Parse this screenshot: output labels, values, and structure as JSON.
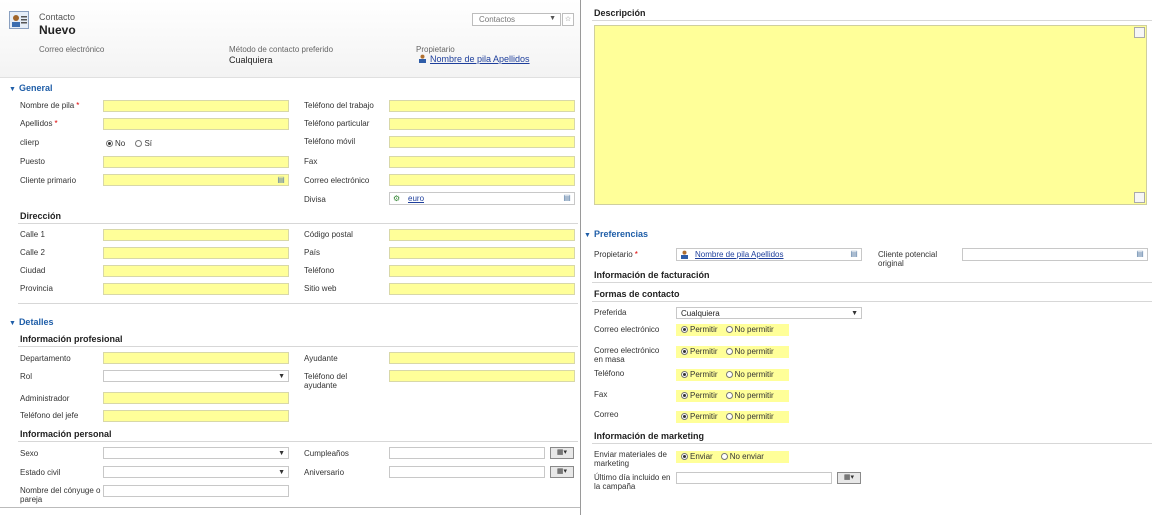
{
  "header": {
    "entity_label": "Contacto",
    "record_title": "Nuevo",
    "form_selector": "Contactos",
    "summary": {
      "email_label": "Correo electrónico",
      "contact_method_label": "Método de contacto preferido",
      "contact_method_value": "Cualquiera",
      "owner_label": "Propietario",
      "owner_value": "Nombre de pila Apellidos"
    }
  },
  "general": {
    "title": "General",
    "first_name": "Nombre de pila",
    "last_name": "Apellidos",
    "clierp": "clierp",
    "clierp_no": "No",
    "clierp_si": "Sí",
    "job_title": "Puesto",
    "primary_customer": "Cliente primario",
    "work_phone": "Teléfono del trabajo",
    "home_phone": "Teléfono particular",
    "mobile_phone": "Teléfono móvil",
    "fax": "Fax",
    "email": "Correo electrónico",
    "currency": "Divisa",
    "currency_value": "euro"
  },
  "address": {
    "title": "Dirección",
    "street1": "Calle 1",
    "street2": "Calle 2",
    "city": "Ciudad",
    "province": "Provincia",
    "postal_code": "Código postal",
    "country": "País",
    "phone": "Teléfono",
    "website": "Sitio web"
  },
  "details": {
    "title": "Detalles",
    "professional_title": "Información profesional",
    "department": "Departamento",
    "role": "Rol",
    "manager": "Administrador",
    "manager_phone": "Teléfono del jefe",
    "assistant": "Ayudante",
    "assistant_phone": "Teléfono del ayudante",
    "personal_title": "Información personal",
    "gender": "Sexo",
    "marital_status": "Estado civil",
    "spouse": "Nombre del cónyuge o pareja",
    "birthday": "Cumpleaños",
    "anniversary": "Aniversario"
  },
  "description": {
    "title": "Descripción"
  },
  "preferences": {
    "title": "Preferencias",
    "owner_label": "Propietario",
    "owner_value": "Nombre de pila Apellidos",
    "original_lead": "Cliente potencial original",
    "billing_title": "Información de facturación",
    "contact_methods_title": "Formas de contacto",
    "preferred": "Preferida",
    "preferred_value": "Cualquiera",
    "email": "Correo electrónico",
    "bulk_email": "Correo electrónico en masa",
    "phone": "Teléfono",
    "fax": "Fax",
    "mail": "Correo",
    "allow": "Permitir",
    "disallow": "No permitir",
    "marketing_title": "Información de marketing",
    "send_marketing": "Enviar materiales de marketing",
    "send": "Enviar",
    "dont_send": "No enviar",
    "last_campaign": "Último día incluido en la campaña"
  }
}
